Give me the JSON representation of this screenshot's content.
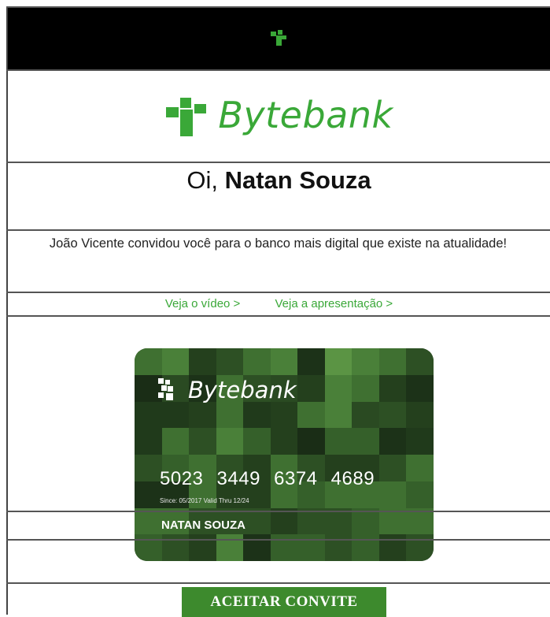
{
  "brand": {
    "name": "Bytebank",
    "color": "#3aa838"
  },
  "greeting": {
    "prefix": "Oi,",
    "name": "Natan Souza"
  },
  "invite": {
    "text": "João Vicente convidou você para o banco mais digital que existe na atualidade!"
  },
  "links": {
    "video": "Veja o vídeo >",
    "presentation": "Veja a apresentação >"
  },
  "card": {
    "brand": "Bytebank",
    "number": "5023 3449 6374 4689",
    "dates": "Since: 05/2017  Valid Thru 12/24",
    "holder": "NATAN SOUZA"
  },
  "cta": {
    "label": "ACEITAR CONVITE",
    "color": "#3d8a2d"
  }
}
